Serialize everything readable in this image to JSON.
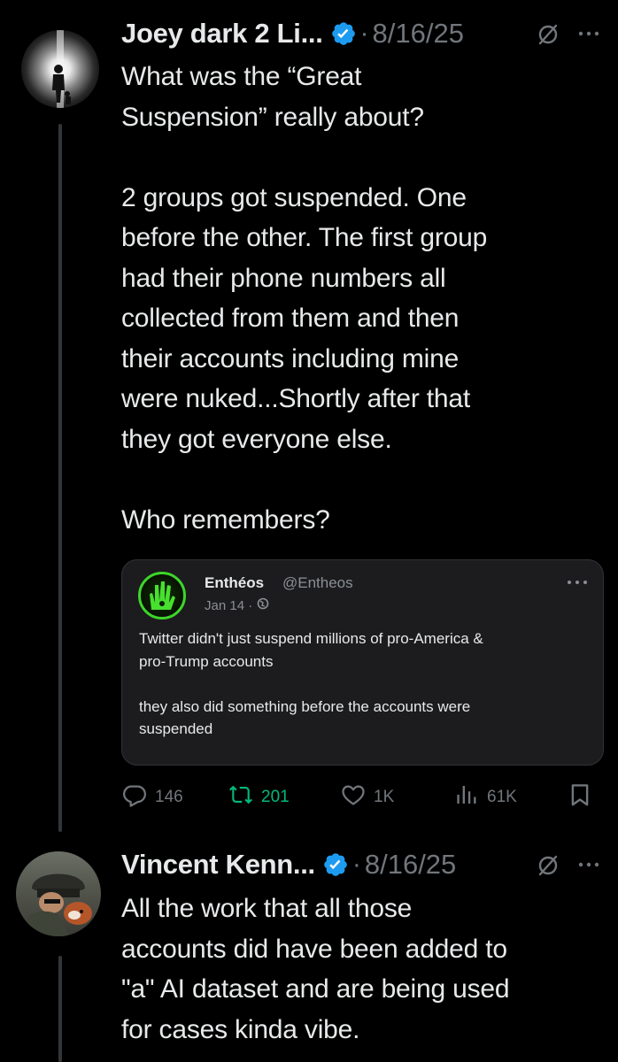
{
  "posts": [
    {
      "author_name": "Joey dark 2 Li...",
      "date": "8/16/25",
      "text": "What was the “Great\nSuspension” really about?\n\n2 groups got suspended. One\nbefore the other. The first group\nhad their phone numbers all\ncollected from them and then\ntheir accounts including mine\nwere nuked...Shortly after that\nthey got everyone else.\n\nWho remembers?",
      "quote": {
        "name": "Enthéos",
        "handle": "@Entheos",
        "date": "Jan 14 ·",
        "text": "Twitter didn't just suspend millions of pro-America &\npro-Trump accounts\n\nthey also did something before the accounts were\nsuspended"
      },
      "actions": {
        "replies": "146",
        "reposts": "201",
        "likes": "1K",
        "views": "61K"
      }
    },
    {
      "author_name": "Vincent Kenn...",
      "date": "8/16/25",
      "text": "All the work that all those\naccounts did have been added to\n\"a\" AI dataset and are being used\nfor cases kinda vibe."
    }
  ],
  "separator": "·",
  "icons": {
    "verified": "verified-badge-icon",
    "grok": "grok-icon",
    "more": "more-icon",
    "reply": "reply-icon",
    "repost": "repost-icon",
    "like": "like-icon",
    "views": "views-icon",
    "bookmark": "bookmark-icon"
  },
  "colors": {
    "background": "#000000",
    "text": "#e7e9ea",
    "muted": "#71767b",
    "verified": "#1d9bf0",
    "repost": "#00ba7c"
  }
}
